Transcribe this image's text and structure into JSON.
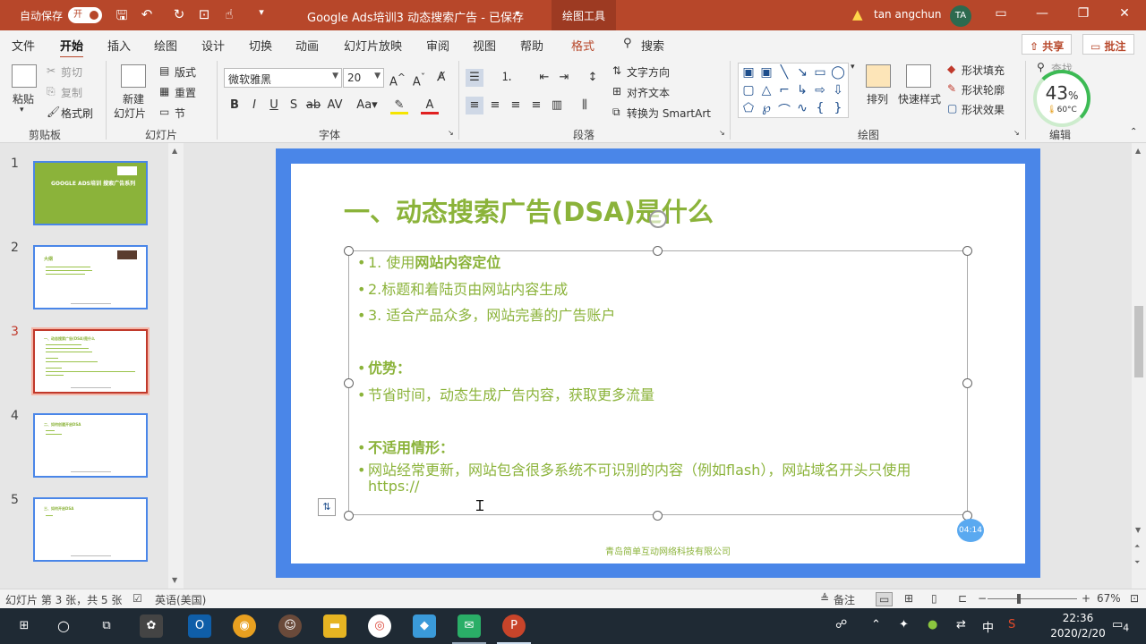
{
  "titlebar": {
    "autosave_label": "自动保存",
    "autosave_state": "开",
    "doc_title": "Google Ads培训3 动态搜索广告 - 已保存",
    "context_tab": "绘图工具",
    "user_name": "tan angchun",
    "user_initials": "TA",
    "icons": [
      "save-icon",
      "undo-icon",
      "redo-icon",
      "start-presentation-icon",
      "touch-mode-icon",
      "customize-qat-icon",
      "warning-icon",
      "ribbon-display-icon",
      "minimize-icon",
      "restore-icon",
      "close-icon"
    ]
  },
  "menu": {
    "tabs": [
      "文件",
      "开始",
      "插入",
      "绘图",
      "设计",
      "切换",
      "动画",
      "幻灯片放映",
      "审阅",
      "视图",
      "帮助",
      "格式"
    ],
    "active_tab": "开始",
    "search_label": "搜索",
    "share_label": "共享",
    "comments_label": "批注"
  },
  "ribbon": {
    "clipboard": {
      "paste": "粘贴",
      "cut": "剪切",
      "copy": "复制",
      "format_painter": "格式刷",
      "group": "剪贴板"
    },
    "slides": {
      "new_slide_line1": "新建",
      "new_slide_line2": "幻灯片",
      "layout": "版式",
      "reset": "重置",
      "section": "节",
      "group": "幻灯片"
    },
    "font": {
      "name": "微软雅黑",
      "size": "20",
      "group": "字体"
    },
    "paragraph": {
      "text_direction": "文字方向",
      "align_text": "对齐文本",
      "smartart": "转换为 SmartArt",
      "group": "段落"
    },
    "drawing": {
      "arrange": "排列",
      "quick_styles": "快速样式",
      "shape_fill": "形状填充",
      "shape_outline": "形状轮廓",
      "shape_effects": "形状效果",
      "group": "绘图"
    },
    "editing": {
      "find": "查找",
      "group": "编辑"
    },
    "gauge": {
      "percent": "43",
      "percent_sign": "%",
      "temperature": "60°C"
    }
  },
  "thumbnails": [
    {
      "number": "1",
      "title": "GOOGLE ADS培训 搜索广告系列"
    },
    {
      "number": "2",
      "title": "大纲"
    },
    {
      "number": "3",
      "title": "一、动态搜索广告(DSA)是什么",
      "active": true
    },
    {
      "number": "4",
      "title": "二、如何创建开启DSA"
    },
    {
      "number": "5",
      "title": "三、如何开启DSA"
    }
  ],
  "slide": {
    "title": "一、动态搜索广告(DSA)是什么",
    "bullets": [
      {
        "prefix": "1. 使用",
        "bold": "网站内容定位",
        "text": ""
      },
      {
        "prefix": "2.标题和着陆页由网站内容生成",
        "bold": "",
        "text": ""
      },
      {
        "prefix": "3. 适合产品众多，网站完善的广告账户",
        "bold": "",
        "text": ""
      },
      {
        "prefix": "",
        "bold": "优势：",
        "text": ""
      },
      {
        "prefix": "节省时间，动态生成广告内容，获取更多流量",
        "bold": "",
        "text": ""
      },
      {
        "prefix": "",
        "bold": "不适用情形：",
        "text": ""
      },
      {
        "prefix": "网站经常更新，网站包含很多系统不可识别的内容（例如flash），网站域名开头只使用https://",
        "bold": "",
        "text": ""
      }
    ],
    "bullet_glyph": "•",
    "footer": "青岛简单互动网络科技有限公司",
    "timer": "04:14",
    "accent_color": "#8bb33a",
    "frame_color": "#4a86e8"
  },
  "statusbar": {
    "slide_info": "幻灯片 第 3 张，共 5 张",
    "language": "英语(美国)",
    "notes": "备注",
    "zoom_minus": "−",
    "zoom_plus": "+",
    "zoom": "67%"
  },
  "taskbar": {
    "time": "22:36",
    "date": "2020/2/20",
    "ime": "中",
    "notifications": "4"
  }
}
